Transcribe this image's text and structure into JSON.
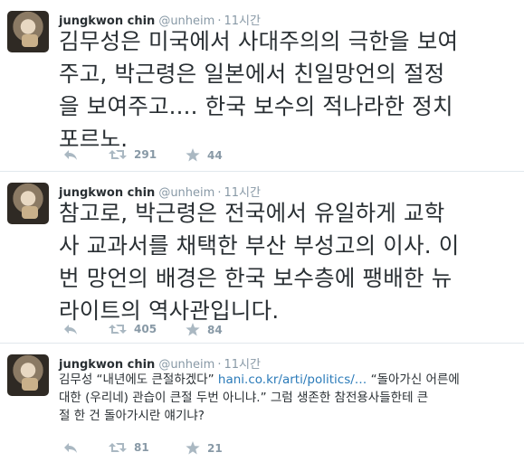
{
  "tweets": [
    {
      "name": "jungkwon chin",
      "handle": "@unheim",
      "sep": "·",
      "time": "11시간",
      "lines": [
        "김무성은 미국에서 사대주의의 극한을 보여",
        "주고, 박근령은 일본에서 친일망언의 절정",
        "을 보여주고.... 한국 보수의 적나라한 정치",
        "포르노."
      ],
      "retweets": "291",
      "favorites": "44"
    },
    {
      "name": "jungkwon chin",
      "handle": "@unheim",
      "sep": "·",
      "time": "11시간",
      "lines": [
        "참고로, 박근령은 전국에서 유일하게 교학",
        "사 교과서를 채택한 부산 부성고의 이사. 이",
        "번 망언의 배경은 한국 보수층에 팽배한 뉴",
        "라이트의 역사관입니다."
      ],
      "retweets": "405",
      "favorites": "84"
    },
    {
      "name": "jungkwon chin",
      "handle": "@unheim",
      "sep": "·",
      "time": "11시간",
      "line1_a": "김무성 “내년에도 큰절하겠다” ",
      "line1_link": "hani.co.kr/arti/politics/…",
      "line1_b": " “돌아가신 어른에",
      "line2": "대한 (우리네) 관습이 큰절 두번 아니냐.” 그럼 생존한 참전용사들한테 큰",
      "line3": "절 한 건 돌아가시란 얘기냐?",
      "retweets": "81",
      "favorites": "21"
    }
  ],
  "colors": {
    "link": "#2b7bb9",
    "muted": "#8899a6",
    "text": "#292f33"
  },
  "icons": [
    "reply-icon",
    "retweet-icon",
    "favorite-star-icon"
  ]
}
